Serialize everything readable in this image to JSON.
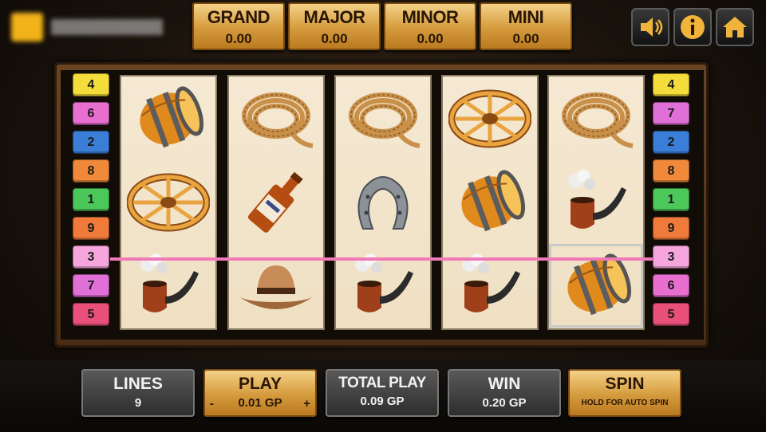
{
  "jackpots": [
    {
      "label": "GRAND",
      "value": "0.00"
    },
    {
      "label": "MAJOR",
      "value": "0.00"
    },
    {
      "label": "MINOR",
      "value": "0.00"
    },
    {
      "label": "MINI",
      "value": "0.00"
    }
  ],
  "top_buttons": [
    {
      "icon": "speaker-icon"
    },
    {
      "icon": "info-icon"
    },
    {
      "icon": "home-icon"
    }
  ],
  "line_badges_left": [
    {
      "number": "4",
      "color": "#f4dc3a"
    },
    {
      "number": "6",
      "color": "#e86fd0"
    },
    {
      "number": "2",
      "color": "#3a7ed8"
    },
    {
      "number": "8",
      "color": "#f08a3a"
    },
    {
      "number": "1",
      "color": "#4cc85a"
    },
    {
      "number": "9",
      "color": "#f07a3a"
    },
    {
      "number": "3",
      "color": "#f6a6dc"
    },
    {
      "number": "7",
      "color": "#e070d8"
    },
    {
      "number": "5",
      "color": "#e8507a"
    }
  ],
  "line_badges_right": [
    {
      "number": "4",
      "color": "#f4dc3a"
    },
    {
      "number": "7",
      "color": "#e070d8"
    },
    {
      "number": "2",
      "color": "#3a7ed8"
    },
    {
      "number": "8",
      "color": "#f08a3a"
    },
    {
      "number": "1",
      "color": "#4cc85a"
    },
    {
      "number": "9",
      "color": "#f07a3a"
    },
    {
      "number": "3",
      "color": "#f6a6dc"
    },
    {
      "number": "6",
      "color": "#e86fd0"
    },
    {
      "number": "5",
      "color": "#e8507a"
    }
  ],
  "reels": [
    [
      "barrel",
      "wagon-wheel",
      "pipe"
    ],
    [
      "rope",
      "whiskey-bottle",
      "cowboy-hat"
    ],
    [
      "rope",
      "horseshoe",
      "pipe"
    ],
    [
      "wagon-wheel",
      "barrel",
      "pipe"
    ],
    [
      "rope",
      "pipe",
      "barrel"
    ]
  ],
  "highlighted_symbol": {
    "reel": 5,
    "row": 3
  },
  "payline_color": "#f07ab8",
  "controls": {
    "lines": {
      "label": "LINES",
      "value": "9"
    },
    "play": {
      "label": "PLAY",
      "value": "0.01 GP",
      "minus": "-",
      "plus": "+"
    },
    "total_play": {
      "label": "TOTAL PLAY",
      "value": "0.09 GP"
    },
    "win": {
      "label": "WIN",
      "value": "0.20 GP"
    },
    "spin": {
      "label": "SPIN",
      "sub": "HOLD FOR AUTO SPIN"
    }
  }
}
